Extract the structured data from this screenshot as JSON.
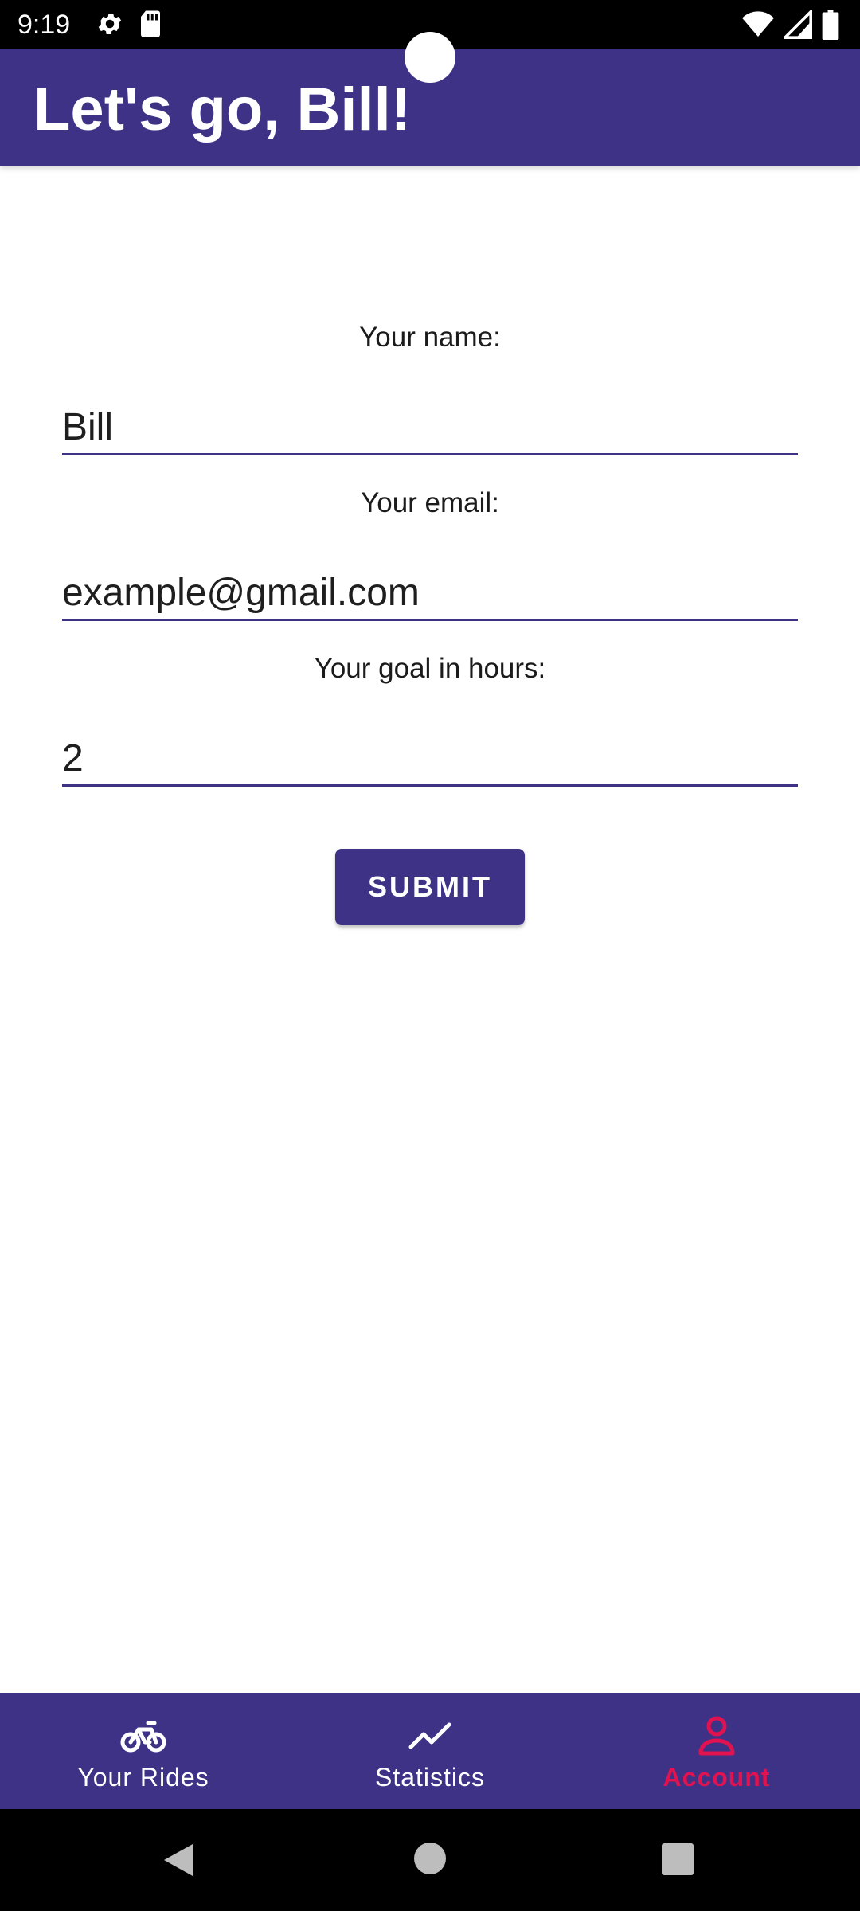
{
  "status_bar": {
    "time": "9:19",
    "left_icons": [
      "gear-icon",
      "sd-card-icon"
    ],
    "right_icons": [
      "wifi-icon",
      "signal-icon",
      "battery-icon"
    ]
  },
  "app_bar": {
    "title": "Let's go, Bill!"
  },
  "form": {
    "name_label": "Your name:",
    "name_value": "Bill",
    "email_label": "Your email:",
    "email_value": "example@gmail.com",
    "goal_label": "Your goal in hours:",
    "goal_value": "2",
    "submit_label": "SUBMIT"
  },
  "bottom_nav": {
    "items": [
      {
        "label": "Your Rides",
        "icon": "bike-icon"
      },
      {
        "label": "Statistics",
        "icon": "trend-icon"
      },
      {
        "label": "Account",
        "icon": "person-icon",
        "active": true
      }
    ]
  },
  "colors": {
    "primary": "#3e3287",
    "accent": "#e0124f"
  }
}
